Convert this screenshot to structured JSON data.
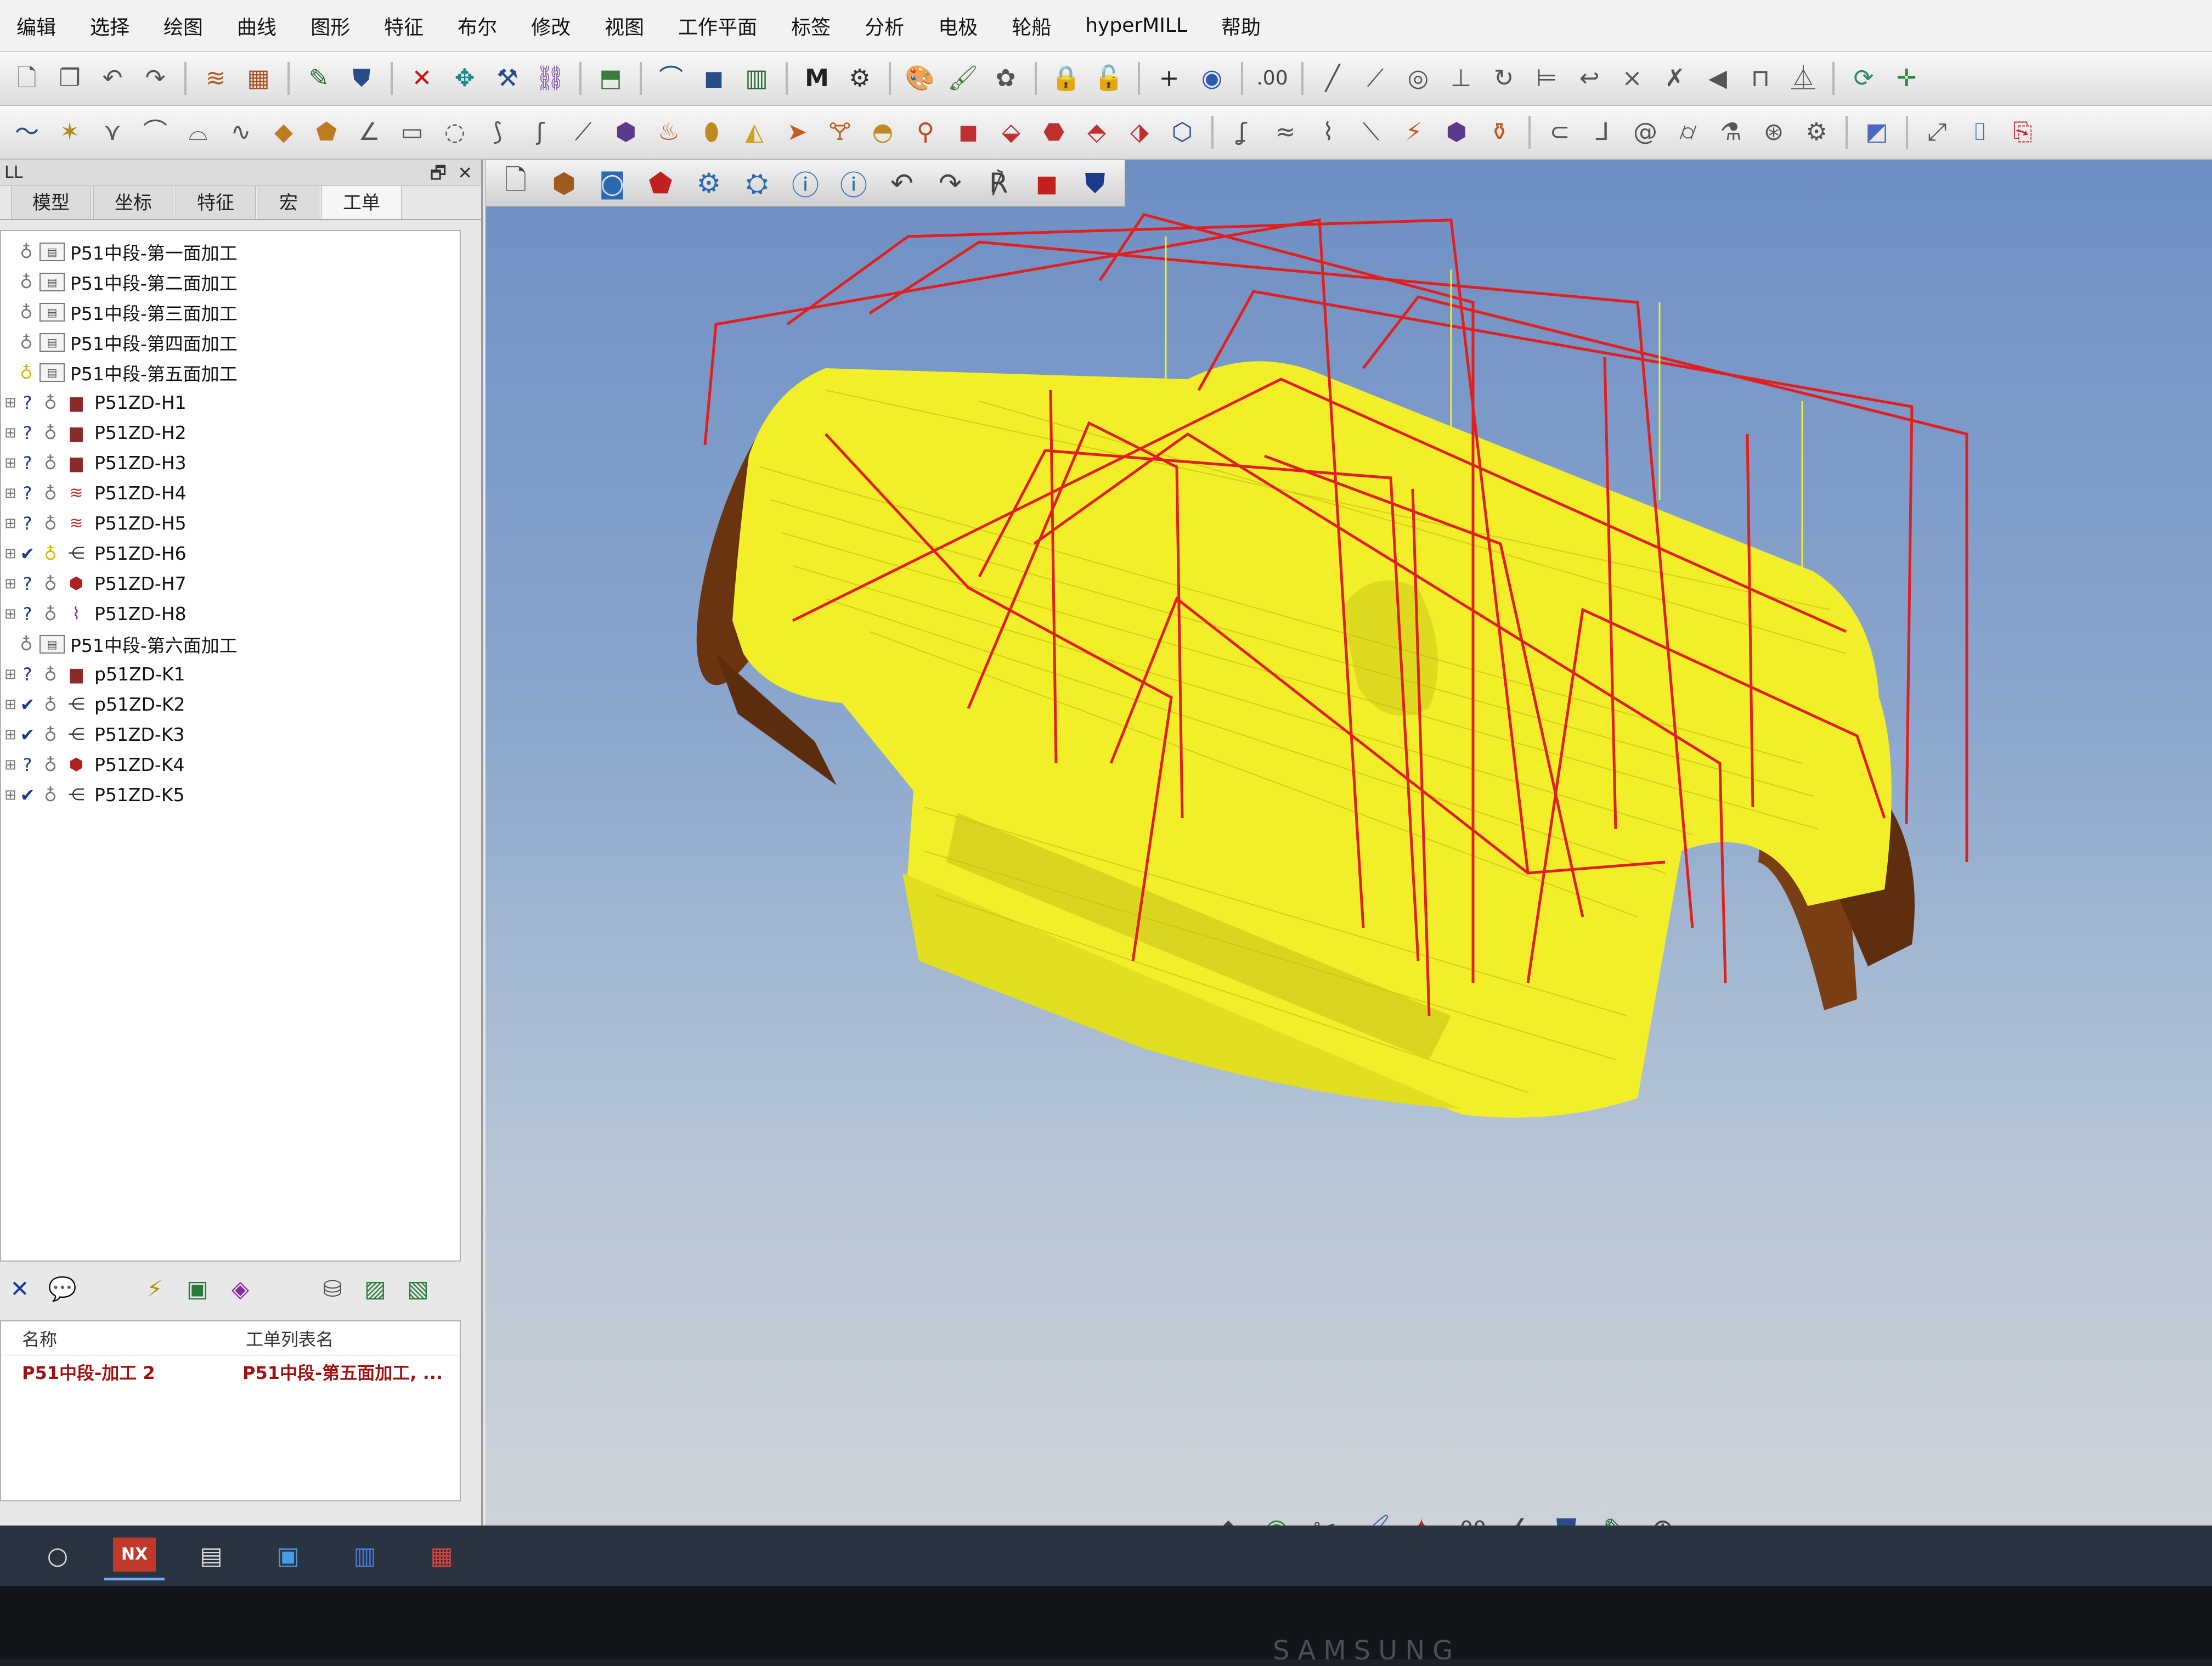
{
  "menubar": {
    "items": [
      "编辑",
      "选择",
      "绘图",
      "曲线",
      "图形",
      "特征",
      "布尔",
      "修改",
      "视图",
      "工作平面",
      "标签",
      "分析",
      "电极",
      "轮船",
      "hyperMILL",
      "帮助"
    ]
  },
  "left_panel": {
    "title": "LL",
    "tabs": [
      "模型",
      "坐标",
      "特征",
      "宏",
      "工单"
    ],
    "active_tab": "工单",
    "tree": [
      {
        "type": "list",
        "label": "P51中段-第一面加工"
      },
      {
        "type": "list",
        "label": "P51中段-第二面加工"
      },
      {
        "type": "list",
        "label": "P51中段-第三面加工"
      },
      {
        "type": "list",
        "label": "P51中段-第四面加工"
      },
      {
        "type": "list",
        "label": "P51中段-第五面加工",
        "active": true
      },
      {
        "type": "job",
        "label": "P51ZD-H1",
        "status": "?"
      },
      {
        "type": "job",
        "label": "P51ZD-H2",
        "status": "?"
      },
      {
        "type": "job",
        "label": "P51ZD-H3",
        "status": "?"
      },
      {
        "type": "job",
        "label": "P51ZD-H4",
        "status": "?"
      },
      {
        "type": "job",
        "label": "P51ZD-H5",
        "status": "?"
      },
      {
        "type": "job",
        "label": "P51ZD-H6",
        "status": "✔"
      },
      {
        "type": "job",
        "label": "P51ZD-H7",
        "status": "?"
      },
      {
        "type": "job",
        "label": "P51ZD-H8",
        "status": "?"
      },
      {
        "type": "list",
        "label": "P51中段-第六面加工"
      },
      {
        "type": "job",
        "label": "p51ZD-K1",
        "status": "?"
      },
      {
        "type": "job",
        "label": "p51ZD-K2",
        "status": "✔"
      },
      {
        "type": "job",
        "label": "P51ZD-K3",
        "status": "✔"
      },
      {
        "type": "job",
        "label": "P51ZD-K4",
        "status": "?"
      },
      {
        "type": "job",
        "label": "P51ZD-K5",
        "status": "✔"
      }
    ],
    "info_table": {
      "headers": [
        "名称",
        "工单列表名"
      ],
      "row": [
        "P51中段-加工 2",
        "P51中段-第五面加工, ..."
      ]
    }
  },
  "colors": {
    "toolpath_yellow": "#f2ef2a",
    "rapid_red": "#e02020",
    "stock_brown": "#7a3e14",
    "viewport_top": "#6e8fc4"
  },
  "monitor_brand": "SAMSUNG"
}
